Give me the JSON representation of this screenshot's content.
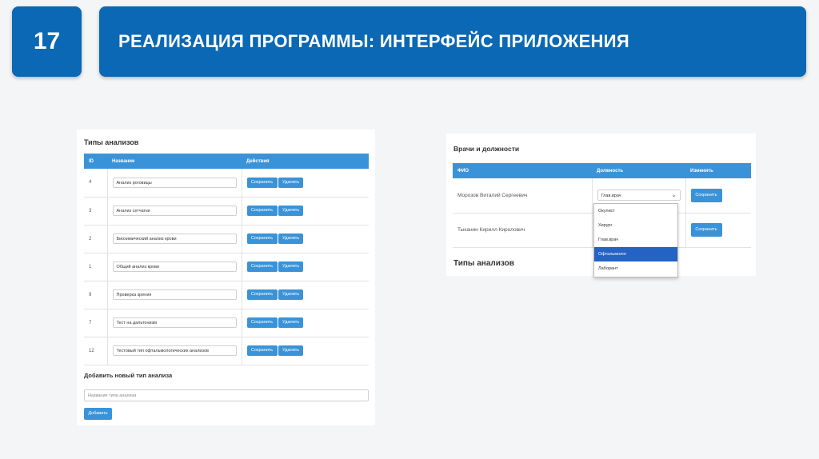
{
  "slide": {
    "number": "17",
    "title": "РЕАЛИЗАЦИЯ ПРОГРАММЫ: ИНТЕРФЕЙС ПРИЛОЖЕНИЯ"
  },
  "left_panel": {
    "heading": "Типы анализов",
    "columns": [
      "ID",
      "Название",
      "Действия"
    ],
    "rows": [
      {
        "id": "4",
        "name": "Анализ роговицы"
      },
      {
        "id": "3",
        "name": "Анализ сетчатки"
      },
      {
        "id": "2",
        "name": "Биохимический анализ крови"
      },
      {
        "id": "1",
        "name": "Общий анализ крови"
      },
      {
        "id": "9",
        "name": "Проверка зрения"
      },
      {
        "id": "7",
        "name": "Тест на дальтонизм"
      },
      {
        "id": "12",
        "name": "Тестовый тип офтальмологических анализов"
      }
    ],
    "save_label": "Сохранить",
    "delete_label": "Удалить",
    "add_heading": "Добавить новый тип анализа",
    "add_placeholder": "Название типа анализа",
    "add_button": "Добавить"
  },
  "right_panel": {
    "heading": "Врачи и должности",
    "columns": [
      "ФИО",
      "Должность",
      "Изменить"
    ],
    "rows": [
      {
        "name": "Морозов Виталий Сергеевич",
        "position": "Глав.врач"
      },
      {
        "name": "Тыканин Кирилл Киролович",
        "position": ""
      }
    ],
    "save_label": "Сохранить",
    "dropdown_options": [
      "Окулист",
      "Хирург",
      "Глав.врач",
      "Офтальмолог",
      "Лаборант"
    ],
    "dropdown_highlighted": "Офтальмолог",
    "sub_heading": "Типы анализов"
  },
  "colors": {
    "brand_blue": "#0a68b4",
    "table_header": "#3a93d8",
    "button": "#3a93d8",
    "highlight": "#2462c4"
  }
}
